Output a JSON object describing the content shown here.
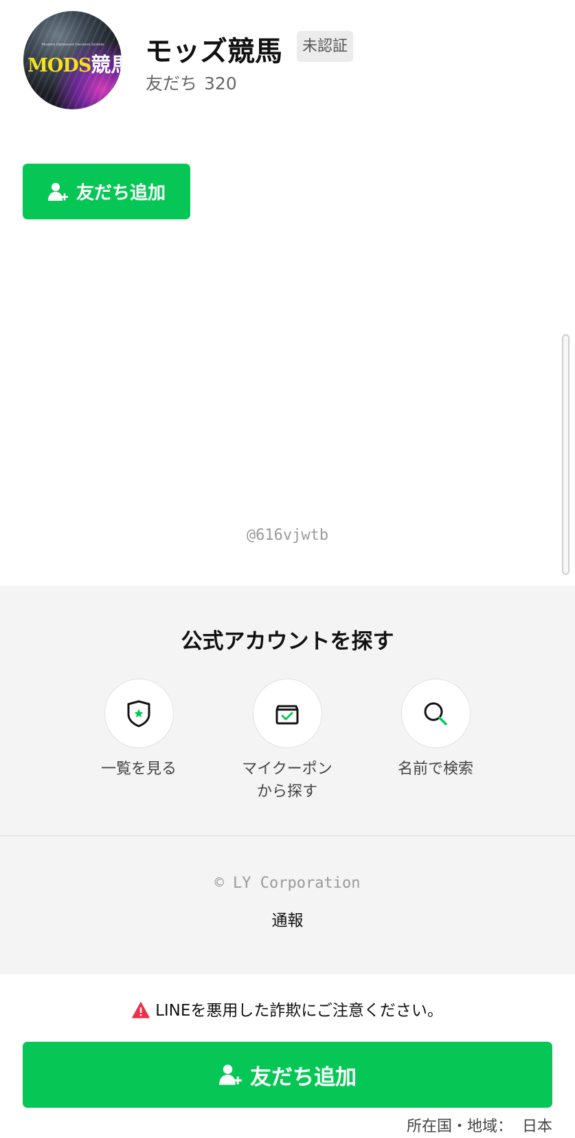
{
  "profile": {
    "avatar_logo_sub": "Modern Optimized Decision System",
    "avatar_logo_latin": "MODS",
    "avatar_logo_kanji": "競馬",
    "name": "モッズ競馬",
    "badge": "未認証",
    "friends_label": "友だち",
    "friends_count": "320"
  },
  "actions": {
    "add_friend_label": "友だち追加",
    "add_friend_icon": "person-plus-icon"
  },
  "account": {
    "id": "@616vjwtb"
  },
  "explore": {
    "title": "公式アカウントを探す",
    "items": [
      {
        "label": "一覧を見る",
        "icon": "shield-star-icon"
      },
      {
        "label": "マイクーポン\nから探す",
        "icon": "coupon-box-icon"
      },
      {
        "label": "名前で検索",
        "icon": "search-icon"
      }
    ]
  },
  "footer": {
    "copyright": "© LY Corporation",
    "report": "通報"
  },
  "warning": {
    "text": "LINEを悪用した詐欺にご注意ください。",
    "icon": "warning-icon"
  },
  "region": {
    "label": "所在国・地域：",
    "value": "日本"
  },
  "colors": {
    "brand_green": "#06c755",
    "warning_red": "#e8334a",
    "explore_bg": "#f4f4f4"
  }
}
